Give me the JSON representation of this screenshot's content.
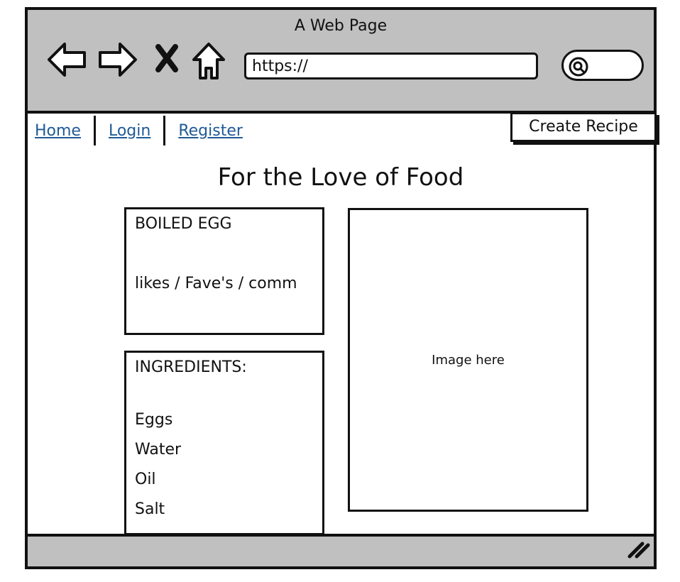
{
  "window": {
    "title": "A Web Page"
  },
  "browser": {
    "nav_icons": [
      "back-icon",
      "forward-icon",
      "stop-icon",
      "home-icon"
    ],
    "address": "https://",
    "search_icon": "search-icon"
  },
  "navbar": {
    "links": [
      "Home",
      "Login",
      "Register"
    ],
    "create_button": "Create Recipe"
  },
  "page": {
    "heading": "For the Love of Food"
  },
  "recipe": {
    "title": "BOILED EGG",
    "meta": "likes / Fave's / comm"
  },
  "ingredients": {
    "heading": "INGREDIENTS:",
    "items": [
      "Eggs",
      "Water",
      "Oil",
      "Salt"
    ]
  },
  "image": {
    "placeholder": "Image here"
  },
  "colors": {
    "chrome": "#c0c0c0",
    "link": "#1f5a96",
    "outline": "#111111"
  }
}
